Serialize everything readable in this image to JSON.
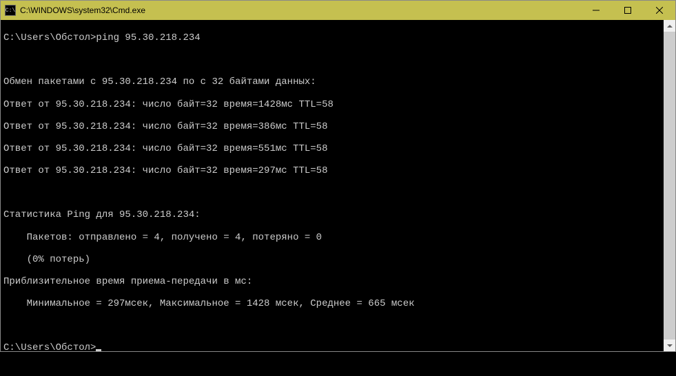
{
  "window": {
    "title": "C:\\WINDOWS\\system32\\Cmd.exe",
    "icon_text": "C:\\"
  },
  "terminal": {
    "prompt1": "C:\\Users\\Обстол>",
    "command1": "ping 95.30.218.234",
    "blank1": "",
    "line_exchange": "Обмен пакетами с 95.30.218.234 по с 32 байтами данных:",
    "reply1": "Ответ от 95.30.218.234: число байт=32 время=1428мс TTL=58",
    "reply2": "Ответ от 95.30.218.234: число байт=32 время=386мс TTL=58",
    "reply3": "Ответ от 95.30.218.234: число байт=32 время=551мс TTL=58",
    "reply4": "Ответ от 95.30.218.234: число байт=32 время=297мс TTL=58",
    "blank2": "",
    "stats_header": "Статистика Ping для 95.30.218.234:",
    "stats_packets": "    Пакетов: отправлено = 4, получено = 4, потеряно = 0",
    "stats_loss": "    (0% потерь)",
    "stats_rtt_header": "Приблизительное время приема-передачи в мс:",
    "stats_rtt": "    Минимальное = 297мсек, Максимальное = 1428 мсек, Среднее = 665 мсек",
    "blank3": "",
    "prompt2": "C:\\Users\\Обстол>"
  },
  "ping_data": {
    "target_ip": "95.30.218.234",
    "packet_size_bytes": 32,
    "replies": [
      {
        "bytes": 32,
        "time_ms": 1428,
        "ttl": 58
      },
      {
        "bytes": 32,
        "time_ms": 386,
        "ttl": 58
      },
      {
        "bytes": 32,
        "time_ms": 551,
        "ttl": 58
      },
      {
        "bytes": 32,
        "time_ms": 297,
        "ttl": 58
      }
    ],
    "sent": 4,
    "received": 4,
    "lost": 0,
    "loss_percent": 0,
    "rtt_min_ms": 297,
    "rtt_max_ms": 1428,
    "rtt_avg_ms": 665
  }
}
